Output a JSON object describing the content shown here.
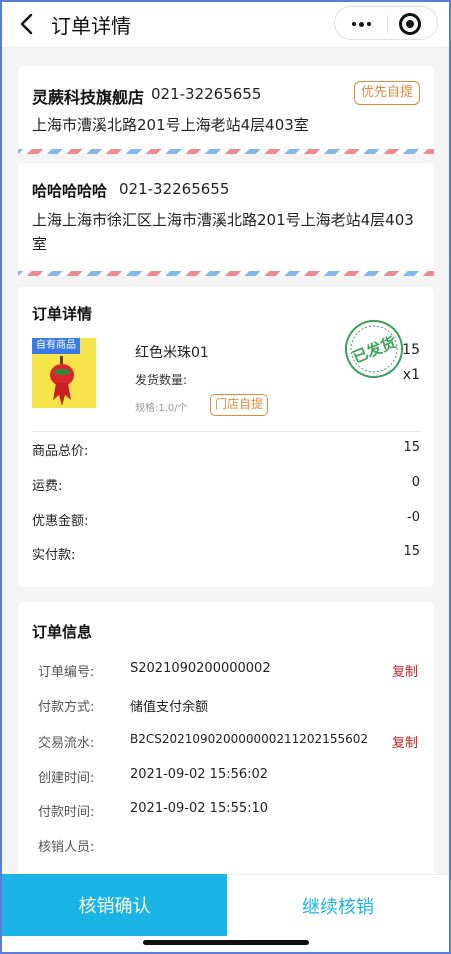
{
  "navbar": {
    "title": "订单详情",
    "back_icon": "chevron-left-icon",
    "more_icon": "more-dots-icon",
    "close_icon": "target-circle-icon"
  },
  "store": {
    "name": "灵蕨科技旗舰店",
    "phone": "021-32265655",
    "pickup_tag": "优先自提",
    "address": "上海市漕溪北路201号上海老站4层403室"
  },
  "customer": {
    "name": "哈哈哈哈哈",
    "phone": "021-32265655",
    "address": "上海上海市徐汇区上海市漕溪北路201号上海老站4层403室"
  },
  "order_detail": {
    "title": "订单详情",
    "product": {
      "badge": "自有商品",
      "name": "红色米珠01",
      "qty_label": "发货数量:",
      "spec": "规格:1.0/个",
      "pickup_tag": "门店自提",
      "price": "15",
      "count": "x1",
      "stamp_text": "已发货"
    },
    "summary": [
      {
        "label": "商品总价:",
        "value": "15"
      },
      {
        "label": "运费:",
        "value": "0"
      },
      {
        "label": "优惠金额:",
        "value": "-0"
      },
      {
        "label": "实付款:",
        "value": "15"
      }
    ]
  },
  "order_info": {
    "title": "订单信息",
    "rows": [
      {
        "label": "订单编号:",
        "value": "S2021090200000002",
        "action": "复制"
      },
      {
        "label": "付款方式:",
        "value": "储值支付余额",
        "action": ""
      },
      {
        "label": "交易流水:",
        "value": "B2CS20210902000000021120215560​2",
        "action": "复制"
      },
      {
        "label": "创建时间:",
        "value": "2021-09-02 15:56:02",
        "action": ""
      },
      {
        "label": "付款时间:",
        "value": "2021-09-02 15:55:10",
        "action": ""
      },
      {
        "label": "核销人员:",
        "value": "",
        "action": ""
      }
    ]
  },
  "buttons": {
    "confirm": "核销确认",
    "continue": "继续核销"
  },
  "colors": {
    "accent": "#1ab4e6",
    "tag_orange": "#e08a3b",
    "copy_red": "#c7222a",
    "stamp_green": "#3aa35a"
  }
}
